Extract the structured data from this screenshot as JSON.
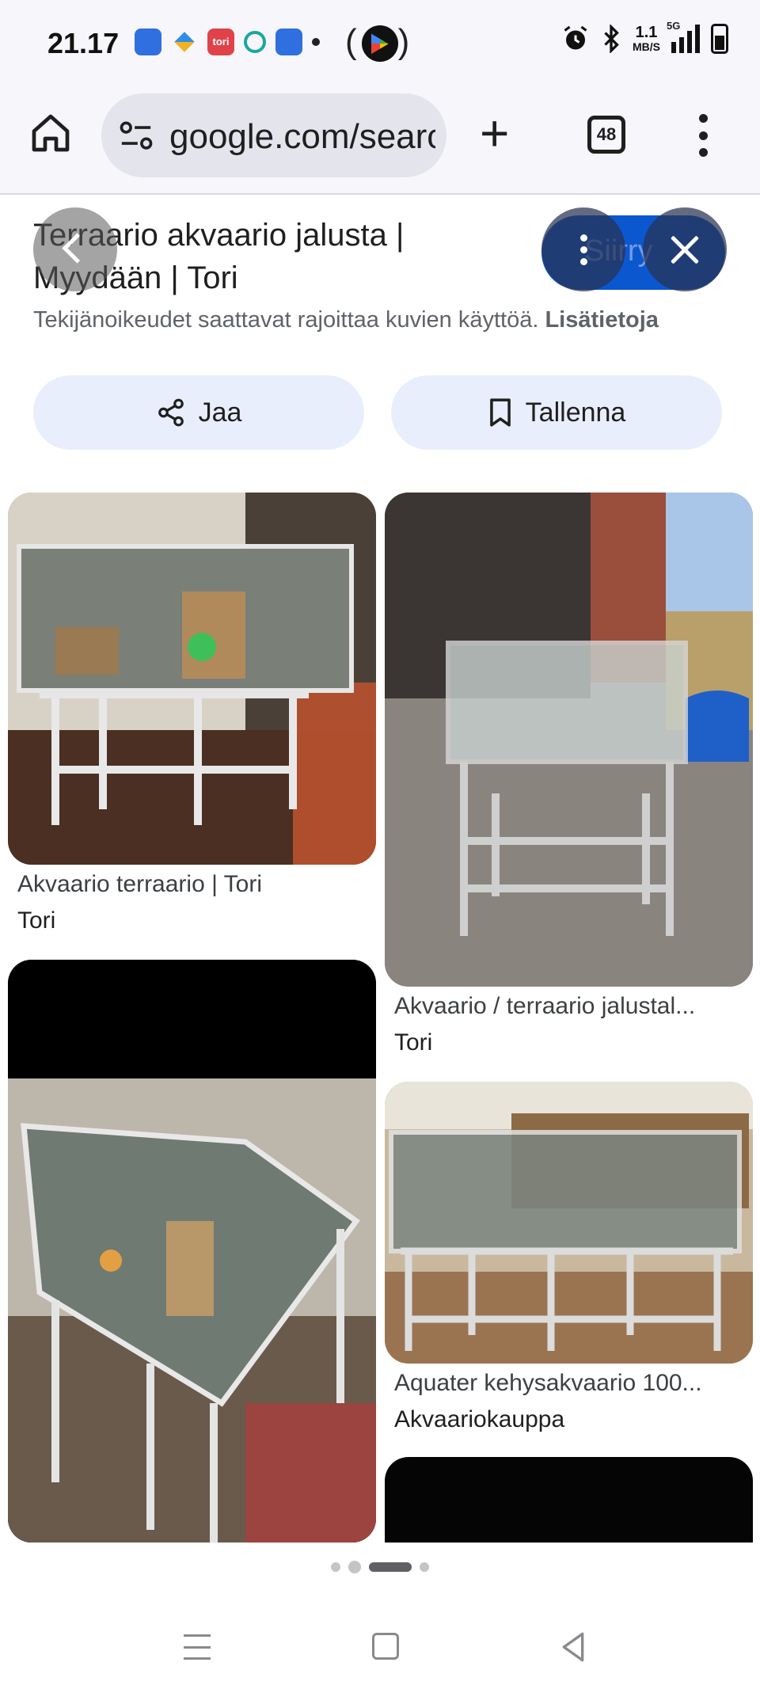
{
  "status_bar": {
    "time": "21.17",
    "notification_icons": [
      "wifi-file-icon",
      "gem-icon",
      "tori-app-icon",
      "cloud-icon",
      "wifi-file-icon",
      "dot-icon"
    ],
    "tori_badge": "tori",
    "speed_value": "1.1",
    "speed_unit": "MB/S",
    "network": "5G"
  },
  "browser": {
    "url": "google.com/search",
    "tab_count": "48"
  },
  "result": {
    "title": "Terraario akvaario jalusta | Myydään | Tori",
    "visit_label": "Siirry",
    "copyright_text": "Tekijänoikeudet saattavat rajoittaa kuvien käyttöä.",
    "copyright_link": "Lisätietoja",
    "share_label": "Jaa",
    "save_label": "Tallenna"
  },
  "related": [
    {
      "title": "Akvaario terraario | Tori",
      "source": "Tori"
    },
    {
      "title": "Akvaario / terraario jalustal...",
      "source": "Tori"
    },
    {
      "title": "Aquater kehysakvaario 100...",
      "source": "Akvaariokauppa"
    }
  ],
  "colors": {
    "accent": "#0b57d0",
    "button_bg": "#e8eefb",
    "toolbar_bg": "#f6f6fb"
  }
}
